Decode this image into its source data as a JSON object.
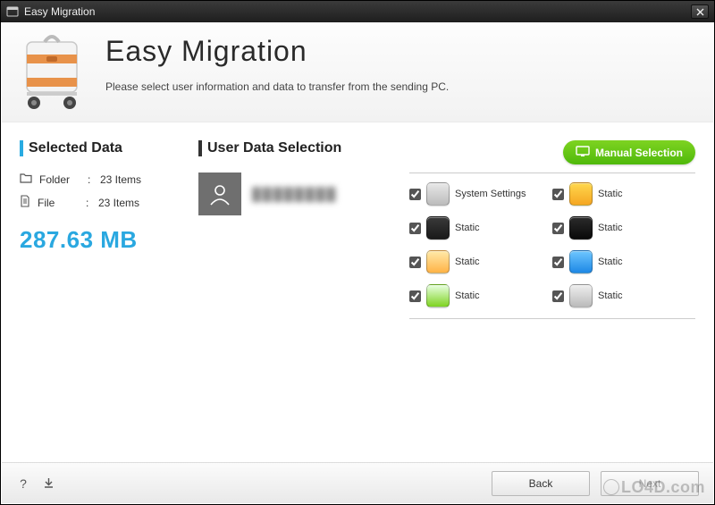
{
  "window": {
    "title": "Easy Migration"
  },
  "header": {
    "app_title": "Easy Migration",
    "instruction": "Please select user information and data to transfer from the sending PC."
  },
  "selected_data": {
    "title": "Selected Data",
    "folder_label": "Folder",
    "folder_value": "23 Items",
    "file_label": "File",
    "file_value": "23 Items",
    "total_size": "287.63 MB"
  },
  "user_selection": {
    "title": "User Data Selection",
    "username": "████████",
    "manual_button": "Manual Selection"
  },
  "data_items": [
    {
      "label": "System Settings",
      "checked": true,
      "icon_bg": "linear-gradient(#e8e8e8,#bcbcbc)",
      "icon_name": "settings-icon"
    },
    {
      "label": "Static",
      "checked": true,
      "icon_bg": "linear-gradient(#ffd84d,#f5a623)",
      "icon_name": "star-icon"
    },
    {
      "label": "Static",
      "checked": true,
      "icon_bg": "linear-gradient(#3a3a3a,#1a1a1a)",
      "icon_name": "music-icon"
    },
    {
      "label": "Static",
      "checked": true,
      "icon_bg": "linear-gradient(#2b2b2b,#0a0a0a)",
      "icon_name": "camera-icon"
    },
    {
      "label": "Static",
      "checked": true,
      "icon_bg": "linear-gradient(#ffe9a8,#ffb347)",
      "icon_name": "folder-icon"
    },
    {
      "label": "Static",
      "checked": true,
      "icon_bg": "linear-gradient(#6ec6ff,#1e88e5)",
      "icon_name": "cursor-icon"
    },
    {
      "label": "Static",
      "checked": true,
      "icon_bg": "linear-gradient(#e8ffe0,#7ed321)",
      "icon_name": "download-icon"
    },
    {
      "label": "Static",
      "checked": true,
      "icon_bg": "linear-gradient(#eee,#bbb)",
      "icon_name": "video-icon"
    }
  ],
  "footer": {
    "back": "Back",
    "next": "Next"
  },
  "watermark": "LO4D.com"
}
